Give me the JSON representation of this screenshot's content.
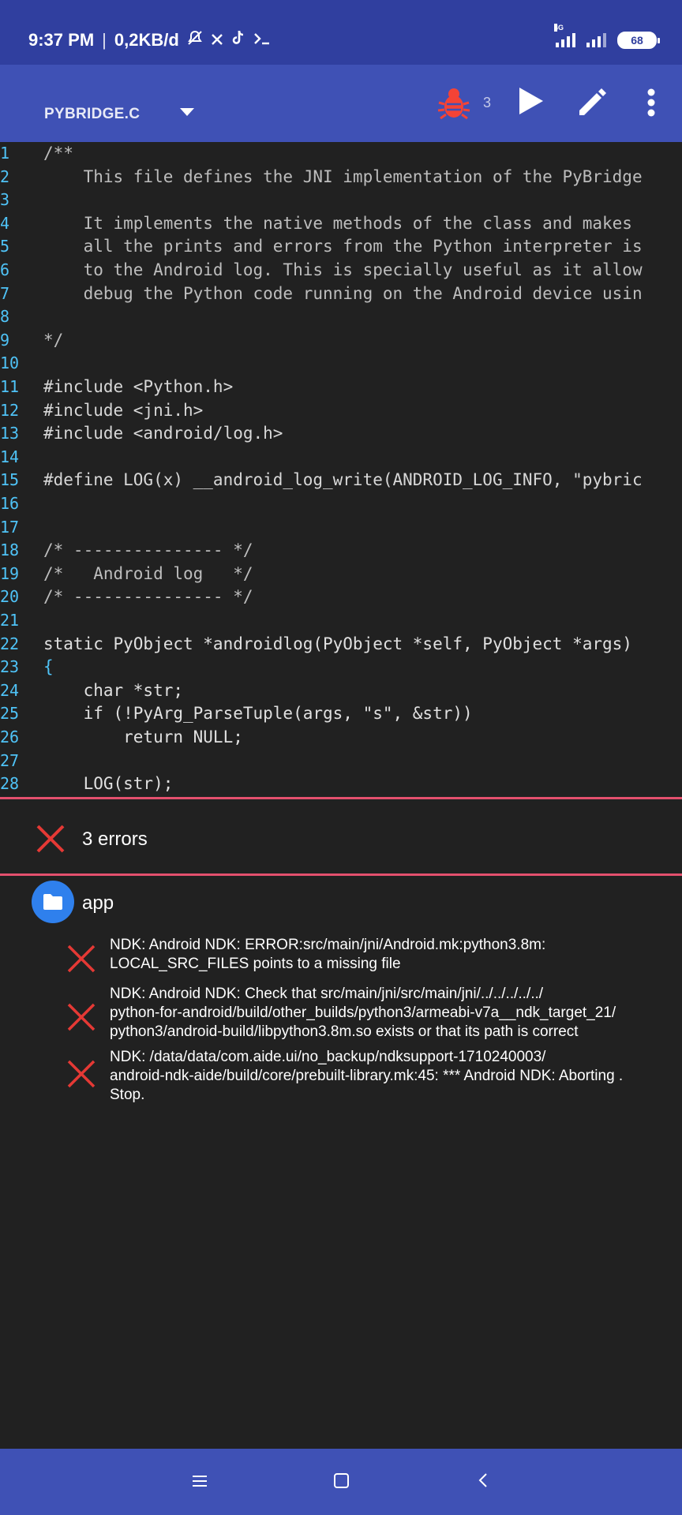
{
  "status_bar": {
    "time": "9:37 PM",
    "separator": "|",
    "speed": "0,2KB/d",
    "lte_label": "4G",
    "battery": "68"
  },
  "toolbar": {
    "file_title": "PYBRIDGE.C",
    "error_count": "3",
    "icons": [
      "bug-icon",
      "play-icon",
      "edit-icon",
      "more-vert-icon"
    ]
  },
  "editor": {
    "line_numbers": [
      "1",
      "2",
      "3",
      "4",
      "5",
      "6",
      "7",
      "8",
      "9",
      "10",
      "11",
      "12",
      "13",
      "14",
      "15",
      "16",
      "17",
      "18",
      "19",
      "20",
      "21",
      "22",
      "23",
      "24",
      "25",
      "26",
      "27",
      "28"
    ],
    "lines": [
      "/**",
      "    This file defines the JNI implementation of the PyBridge",
      "",
      "    It implements the native methods of the class and makes",
      "    all the prints and errors from the Python interpreter is",
      "    to the Android log. This is specially useful as it allow",
      "    debug the Python code running on the Android device usin",
      "",
      "*/",
      "",
      "#include <Python.h>",
      "#include <jni.h>",
      "#include <android/log.h>",
      "",
      "#define LOG(x) __android_log_write(ANDROID_LOG_INFO, \"pybric",
      "",
      "",
      "/* --------------- */",
      "/*   Android log   */",
      "/* --------------- */",
      "",
      "static PyObject *androidlog(PyObject *self, PyObject *args)",
      "{",
      "    char *str;",
      "    if (!PyArg_ParseTuple(args, \"s\", &str))",
      "        return NULL;",
      "",
      "    LOG(str);"
    ]
  },
  "errors_panel": {
    "header": "3 errors",
    "project": "app",
    "items": [
      {
        "text": "NDK: Android NDK: ERROR:src/main/jni/Android.mk:python3.8m:\nLOCAL_SRC_FILES points to a missing file"
      },
      {
        "text": "NDK: Android NDK: Check that src/main/jni/src/main/jni/../../../../../\npython-for-android/build/other_builds/python3/armeabi-v7a__ndk_target_21/\npython3/android-build/libpython3.8m.so exists  or that its path is correct"
      },
      {
        "text": "NDK: /data/data/com.aide.ui/no_backup/ndksupport-1710240003/\nandroid-ndk-aide/build/core/prebuilt-library.mk:45: *** Android NDK: Aborting    .\nStop."
      }
    ]
  },
  "nav_bar": {
    "icons": [
      "menu-icon",
      "home-icon",
      "back-icon"
    ]
  },
  "colors": {
    "status_bar": "#303f9f",
    "toolbar": "#3f51b5",
    "editor_bg": "#212121",
    "line_number": "#4fc3f7",
    "keyword": "#f44336",
    "type": "#4fc3f7",
    "string": "#8bc34a",
    "error_red": "#e53935",
    "divider": "#e4506e",
    "folder": "#2f80ed"
  }
}
